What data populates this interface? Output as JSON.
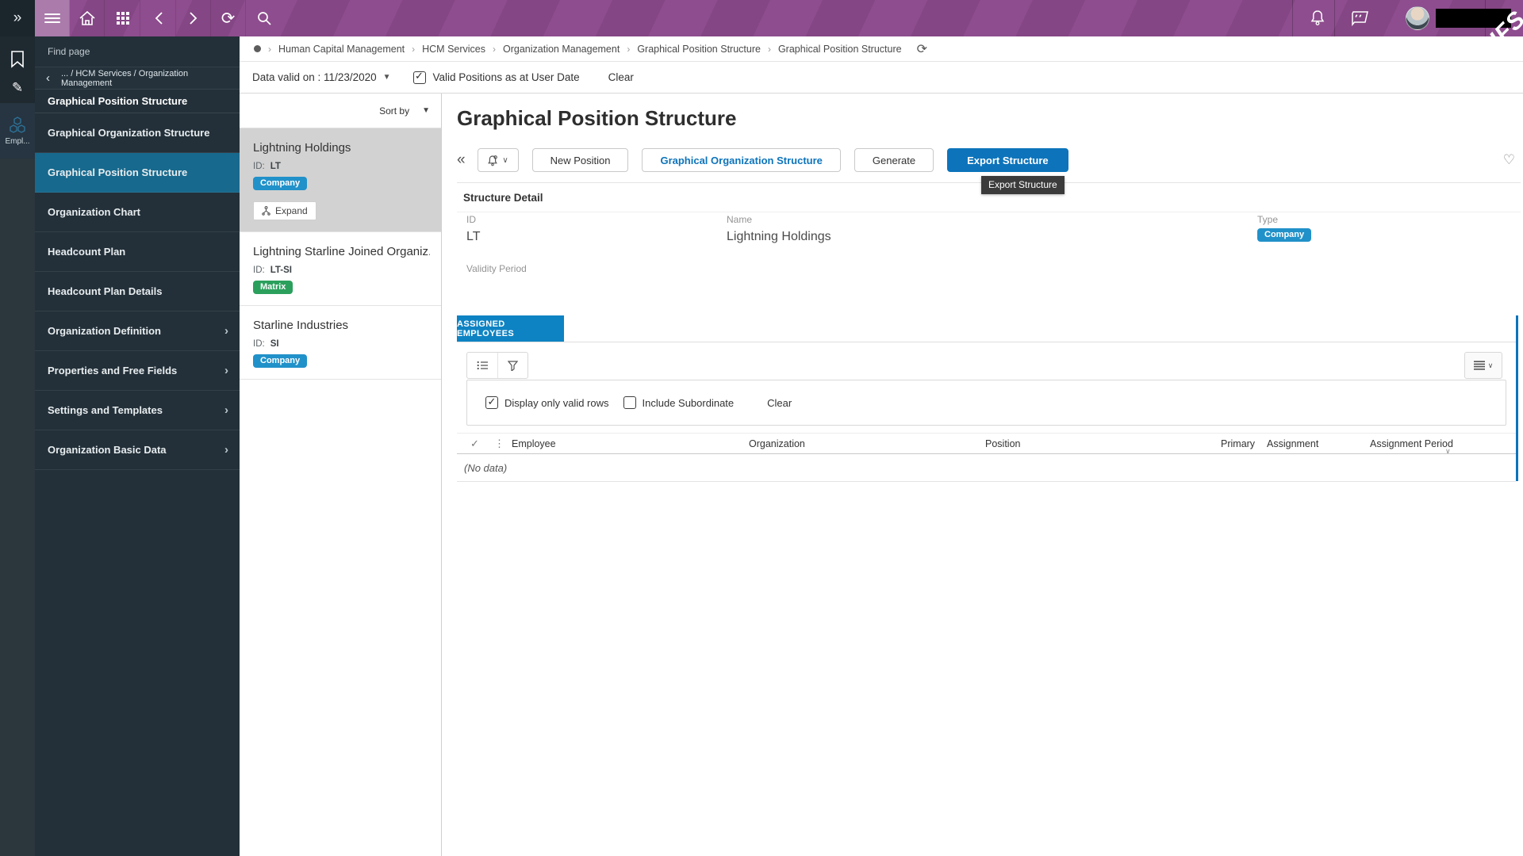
{
  "topbar": {
    "brand": "IFS"
  },
  "rail": {
    "module_label": "Empl..."
  },
  "sidebar": {
    "find_page_placeholder": "Find page",
    "back_path": "... / HCM Services / Organization Management",
    "section_title": "Graphical Position Structure",
    "items": [
      {
        "label": "Graphical Organization Structure"
      },
      {
        "label": "Graphical Position Structure"
      },
      {
        "label": "Organization Chart"
      },
      {
        "label": "Headcount Plan"
      },
      {
        "label": "Headcount Plan Details"
      },
      {
        "label": "Organization Definition"
      },
      {
        "label": "Properties and Free Fields"
      },
      {
        "label": "Settings and Templates"
      },
      {
        "label": "Organization Basic Data"
      }
    ]
  },
  "breadcrumb": {
    "items": [
      "Human Capital Management",
      "HCM Services",
      "Organization Management",
      "Graphical Position Structure",
      "Graphical Position Structure"
    ]
  },
  "filterbar": {
    "data_valid_on": "Data valid on : 11/23/2020",
    "valid_positions": "Valid Positions as at User Date",
    "valid_positions_checked": true,
    "clear": "Clear"
  },
  "org_panel": {
    "sort_by": "Sort by",
    "cards": [
      {
        "title": "Lightning Holdings",
        "id_label": "ID:",
        "id": "LT",
        "badge": "Company",
        "badge_color": "#2191c9",
        "expand": "Expand",
        "selected": true
      },
      {
        "title": "Lightning Starline Joined Organiz...",
        "id_label": "ID:",
        "id": "LT-SI",
        "badge": "Matrix",
        "badge_color": "#2ba05c",
        "selected": false
      },
      {
        "title": "Starline Industries",
        "id_label": "ID:",
        "id": "SI",
        "badge": "Company",
        "badge_color": "#2191c9",
        "selected": false
      }
    ]
  },
  "main": {
    "page_title": "Graphical Position Structure",
    "toolbar": {
      "new_position": "New Position",
      "graphical_organization_structure": "Graphical Organization Structure",
      "generate": "Generate",
      "export_structure": "Export Structure"
    },
    "tooltip": "Export Structure",
    "structure_detail": {
      "header": "Structure Detail",
      "id_label": "ID",
      "id_value": "LT",
      "name_label": "Name",
      "name_value": "Lightning Holdings",
      "type_label": "Type",
      "type_value": "Company",
      "validity_label": "Validity Period"
    },
    "assigned": {
      "tab": "ASSIGNED EMPLOYEES",
      "display_only_valid_rows": "Display only valid rows",
      "display_only_valid_checked": true,
      "include_subordinate": "Include Subordinate",
      "include_subordinate_checked": false,
      "clear": "Clear",
      "columns": [
        "Employee",
        "Organization",
        "Position",
        "Primary",
        "Assignment",
        "Assignment Period"
      ],
      "no_data": "(No data)"
    }
  },
  "colors": {
    "topbar_purple": "#8e4d8e",
    "topbar_active_purple": "#aa7bab",
    "rail_dark": "#1e2930",
    "sidebar_dark": "#233039",
    "selected_teal": "#17698d",
    "primary_blue": "#0d74bb",
    "tab_blue": "#0e83c3",
    "badge_blue": "#2191c9",
    "badge_green": "#2ba05c"
  }
}
